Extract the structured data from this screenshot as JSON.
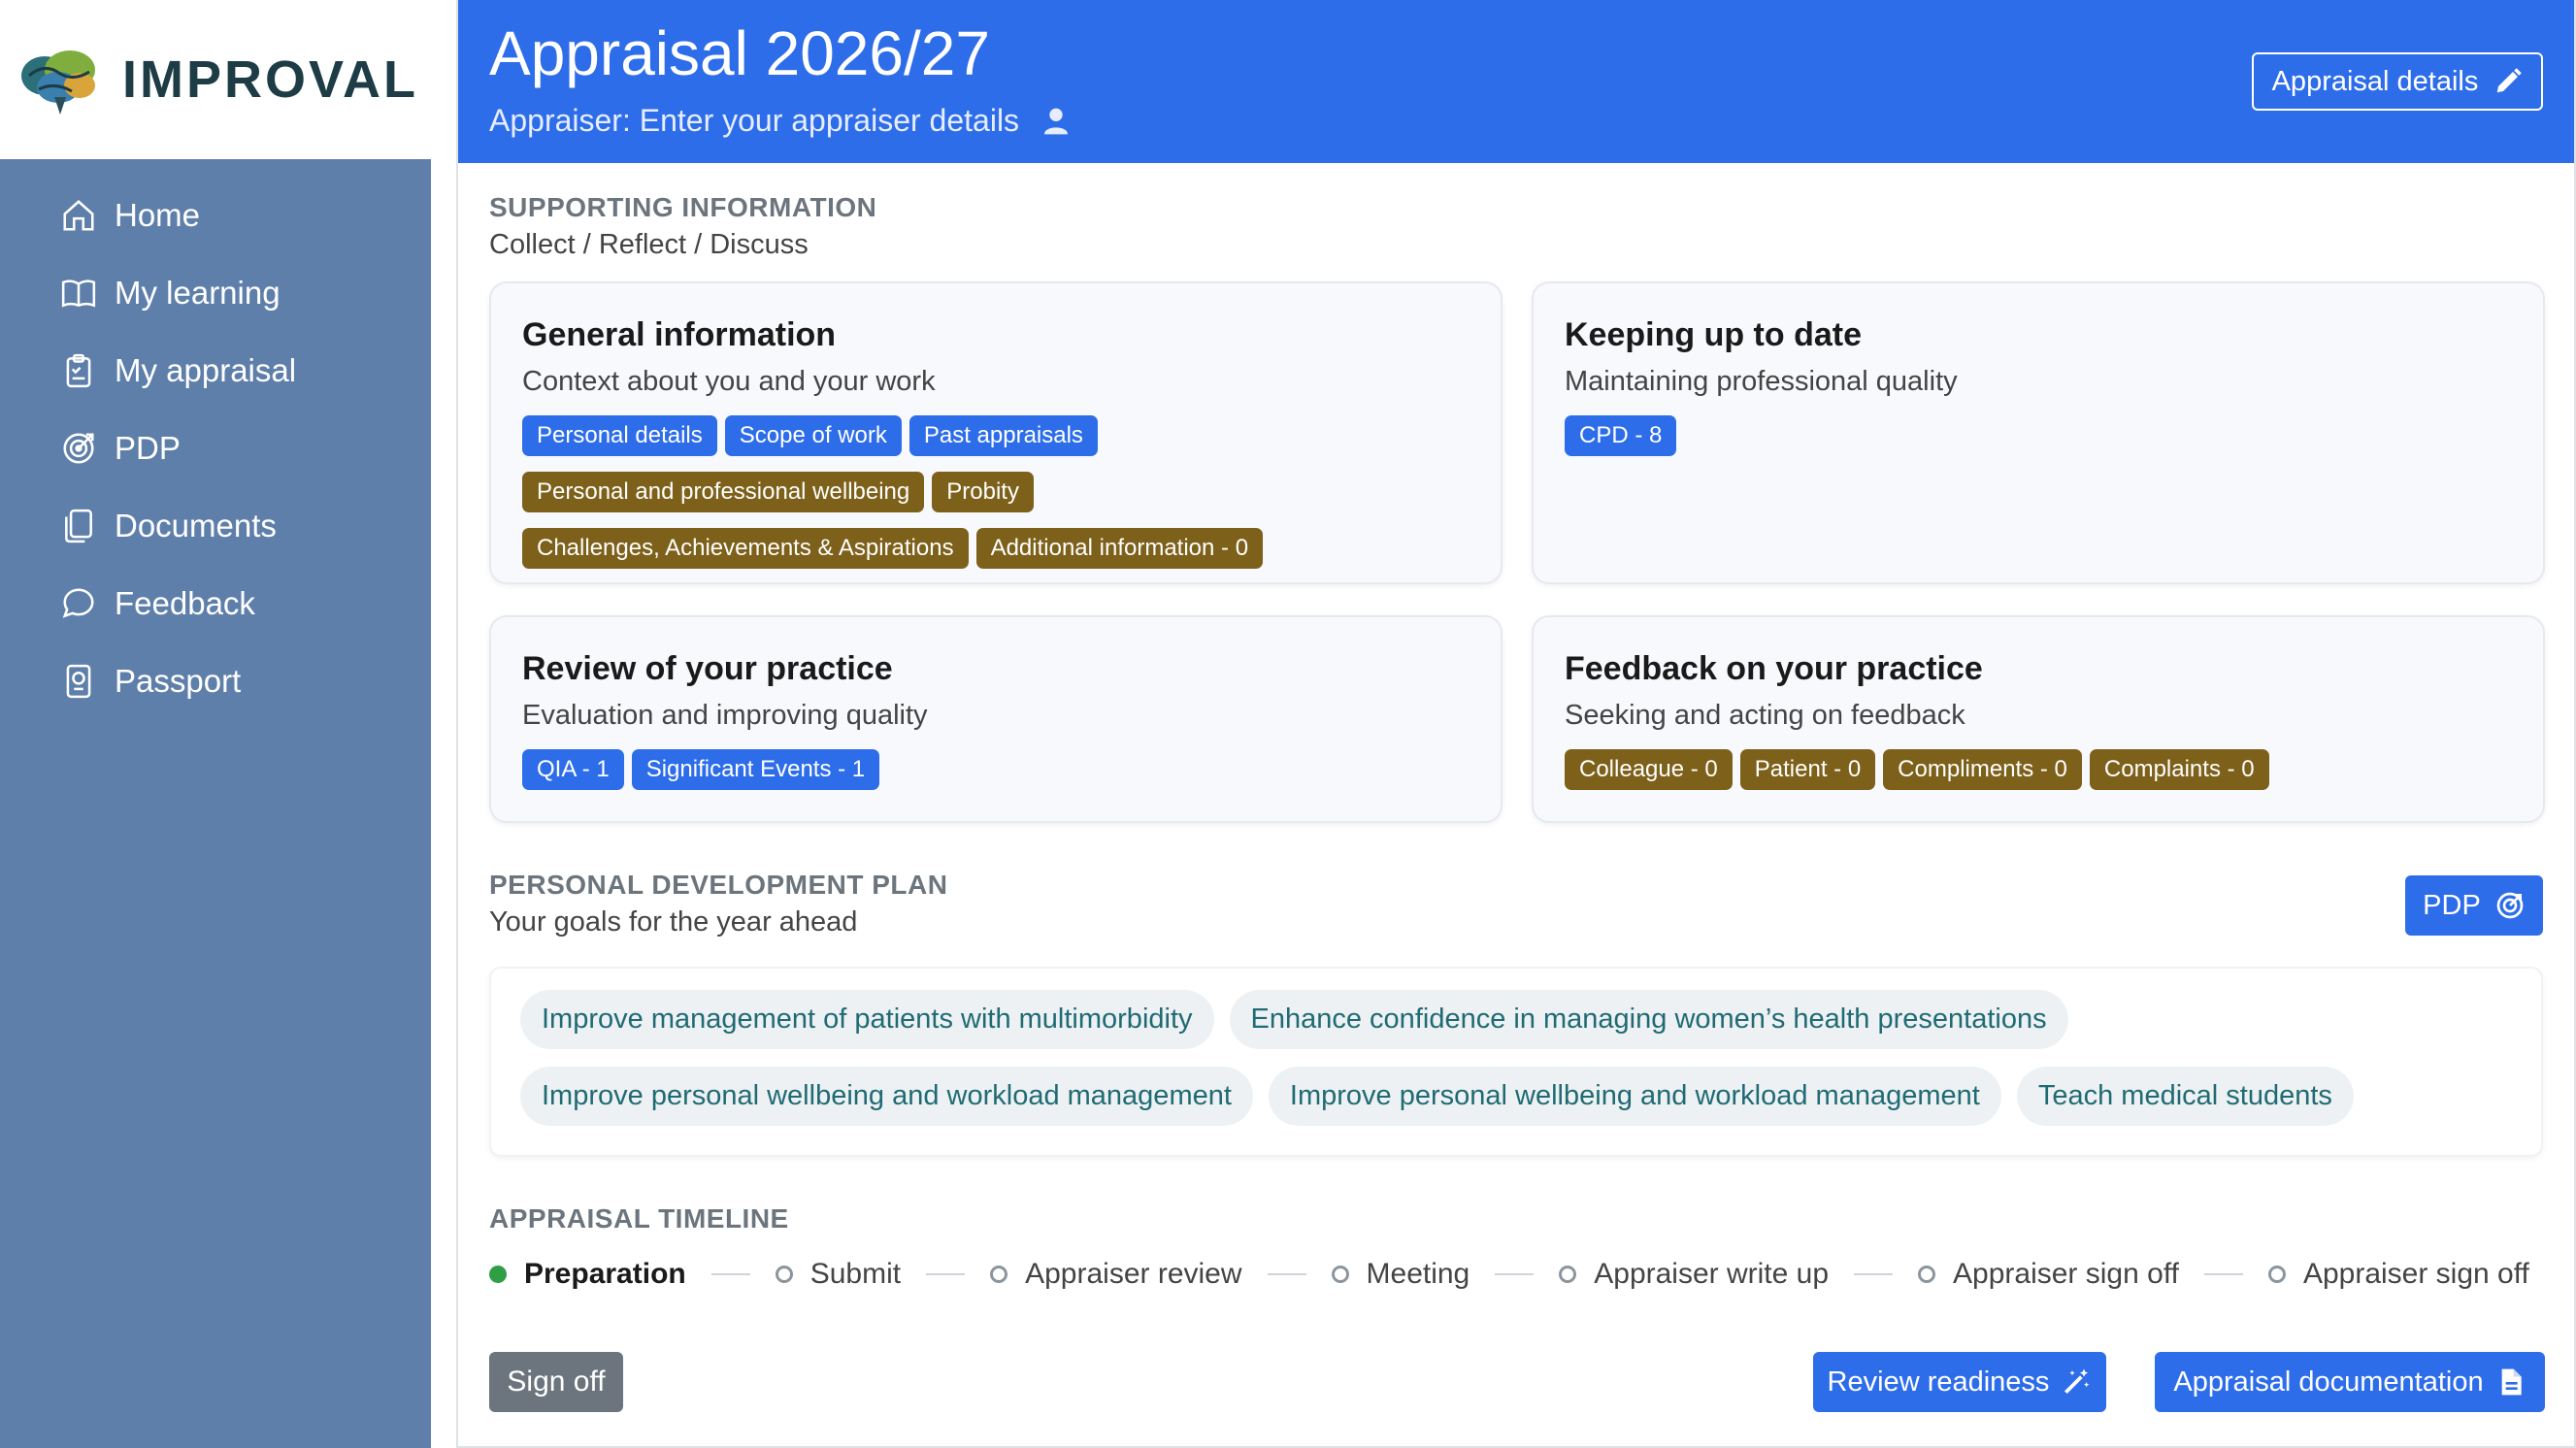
{
  "brand": {
    "name": "IMPROVAL",
    "logo_icon": "brain-logo-icon"
  },
  "sidebar": {
    "items": [
      {
        "label": "Home",
        "icon": "home-icon"
      },
      {
        "label": "My learning",
        "icon": "book-icon"
      },
      {
        "label": "My appraisal",
        "icon": "clipboard-icon"
      },
      {
        "label": "PDP",
        "icon": "target-icon"
      },
      {
        "label": "Documents",
        "icon": "documents-icon"
      },
      {
        "label": "Feedback",
        "icon": "chat-icon"
      },
      {
        "label": "Passport",
        "icon": "passport-icon"
      }
    ]
  },
  "header": {
    "title": "Appraisal 2026/27",
    "subtitle": "Appraiser: Enter your appraiser details",
    "details_button": "Appraisal details"
  },
  "supporting": {
    "heading": "SUPPORTING INFORMATION",
    "subheading": "Collect / Reflect / Discuss",
    "cards": [
      {
        "title": "General information",
        "subtitle": "Context about you and your work",
        "badges": [
          {
            "label": "Personal details",
            "color": "blue"
          },
          {
            "label": "Scope of work",
            "color": "blue"
          },
          {
            "label": "Past appraisals",
            "color": "blue"
          },
          {
            "label": "Personal and professional wellbeing",
            "color": "olive"
          },
          {
            "label": "Probity",
            "color": "olive"
          },
          {
            "label": "Challenges, Achievements & Aspirations",
            "color": "olive"
          },
          {
            "label": "Additional information - 0",
            "color": "olive"
          }
        ]
      },
      {
        "title": "Keeping up to date",
        "subtitle": "Maintaining professional quality",
        "badges": [
          {
            "label": "CPD - 8",
            "color": "blue"
          }
        ]
      },
      {
        "title": "Review of your practice",
        "subtitle": "Evaluation and improving quality",
        "badges": [
          {
            "label": "QIA - 1",
            "color": "blue"
          },
          {
            "label": "Significant Events - 1",
            "color": "blue"
          }
        ]
      },
      {
        "title": "Feedback on your practice",
        "subtitle": "Seeking and acting on feedback",
        "badges": [
          {
            "label": "Colleague - 0",
            "color": "olive"
          },
          {
            "label": "Patient - 0",
            "color": "olive"
          },
          {
            "label": "Compliments - 0",
            "color": "olive"
          },
          {
            "label": "Complaints - 0",
            "color": "olive"
          }
        ]
      }
    ]
  },
  "pdp": {
    "heading": "PERSONAL DEVELOPMENT PLAN",
    "subheading": "Your goals for the year ahead",
    "button": "PDP",
    "goals": [
      "Improve management of patients with multimorbidity",
      "Enhance confidence in managing women’s health presentations",
      "Improve personal wellbeing and workload management",
      "Improve personal wellbeing and workload management",
      "Teach medical students"
    ]
  },
  "timeline": {
    "heading": "APPRAISAL TIMELINE",
    "steps": [
      {
        "label": "Preparation",
        "status": "current"
      },
      {
        "label": "Submit",
        "status": "pending"
      },
      {
        "label": "Appraiser review",
        "status": "pending"
      },
      {
        "label": "Meeting",
        "status": "pending"
      },
      {
        "label": "Appraiser write up",
        "status": "pending"
      },
      {
        "label": "Appraiser sign off",
        "status": "pending"
      },
      {
        "label": "Appraiser sign off",
        "status": "pending"
      }
    ]
  },
  "footer": {
    "sign_off": "Sign off",
    "review_readiness": "Review readiness",
    "documentation": "Appraisal documentation"
  },
  "colors": {
    "primary": "#2e6de9",
    "olive": "#7d6019",
    "sidebar": "#5f7fab",
    "success": "#2f9e44"
  }
}
